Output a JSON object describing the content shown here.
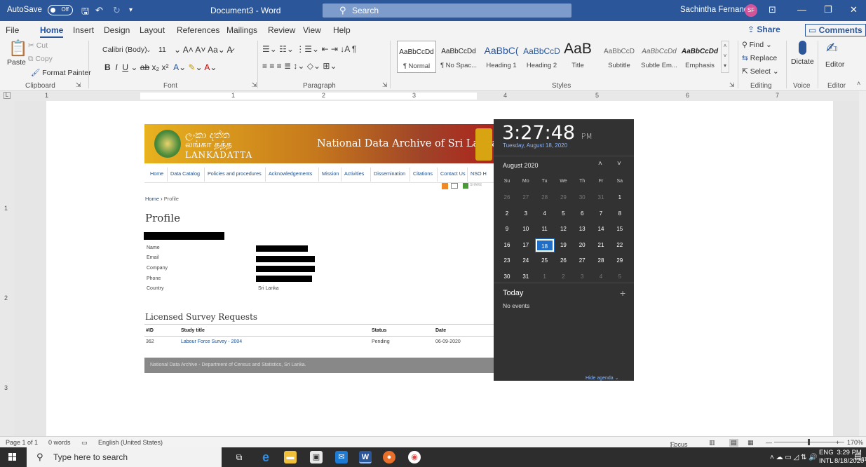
{
  "titlebar": {
    "autosave": "AutoSave",
    "toggle": "Off",
    "doc": "Document3 - Word",
    "search": "Search",
    "user": "Sachintha Fernando",
    "initials": "SF"
  },
  "menu": {
    "items": [
      "File",
      "Home",
      "Insert",
      "Design",
      "Layout",
      "References",
      "Mailings",
      "Review",
      "View",
      "Help"
    ],
    "share": "Share",
    "comments": "Comments"
  },
  "ribbon": {
    "clipboard": {
      "paste": "Paste",
      "cut": "Cut",
      "copy": "Copy",
      "format_painter": "Format Painter",
      "label": "Clipboard"
    },
    "font": {
      "name": "Calibri (Body)",
      "size": "11",
      "label": "Font"
    },
    "paragraph": {
      "label": "Paragraph"
    },
    "styles": {
      "label": "Styles",
      "items": [
        {
          "preview": "AaBbCcDd",
          "name": "¶ Normal"
        },
        {
          "preview": "AaBbCcDd",
          "name": "¶ No Spac..."
        },
        {
          "preview": "AaBbC(",
          "name": "Heading 1"
        },
        {
          "preview": "AaBbCcD",
          "name": "Heading 2"
        },
        {
          "preview": "AaB",
          "name": "Title"
        },
        {
          "preview": "AaBbCcD",
          "name": "Subtitle"
        },
        {
          "preview": "AaBbCcDd",
          "name": "Subtle Em..."
        },
        {
          "preview": "AaBbCcDd",
          "name": "Emphasis"
        }
      ]
    },
    "editing": {
      "find": "Find",
      "replace": "Replace",
      "select": "Select",
      "label": "Editing"
    },
    "voice": {
      "dictate": "Dictate",
      "label": "Voice"
    },
    "editor": {
      "name": "Editor",
      "label": "Editor"
    }
  },
  "ruler": {
    "marks": [
      "1",
      "1",
      "2",
      "3",
      "4",
      "5",
      "6",
      "7"
    ]
  },
  "site": {
    "logo_l1": "ලංකා දත්ත",
    "logo_l2": "லங்கா தத்த",
    "logo_l3": "LANKADATTA",
    "title": "National Data Archive of Sri Lanka",
    "nav": [
      "Home",
      "Data Catalog",
      "Policies and procedures",
      "Acknowledgements",
      "Mission",
      "Activities",
      "Dissemination",
      "Citations",
      "Contact Us",
      "NSO H"
    ],
    "share": "SHARE",
    "breadcrumb_home": "Home",
    "breadcrumb_sep": "›",
    "breadcrumb_cur": "Profile",
    "heading": "Profile",
    "fields": [
      {
        "label": "Name",
        "value": ""
      },
      {
        "label": "Email",
        "value": ""
      },
      {
        "label": "Company",
        "value": ""
      },
      {
        "label": "Phone",
        "value": ""
      },
      {
        "label": "Country",
        "value": "Sri Lanka"
      }
    ],
    "lsr_heading": "Licensed Survey Requests",
    "table": {
      "headers": [
        "#ID",
        "Study title",
        "Status",
        "Date"
      ],
      "rows": [
        [
          "362",
          "Labour Force Survey - 2004",
          "Pending",
          "06-09-2020"
        ]
      ]
    },
    "footer": "National Data Archive - Department of Census and Statistics, Sri Lanka."
  },
  "flyout": {
    "time": "3:27:48",
    "ampm": "PM",
    "date": "Tuesday, August 18, 2020",
    "month": "August 2020",
    "dows": [
      "Su",
      "Mo",
      "Tu",
      "We",
      "Th",
      "Fr",
      "Sa"
    ],
    "days": [
      [
        "26",
        "27",
        "28",
        "29",
        "30",
        "31",
        "1"
      ],
      [
        "2",
        "3",
        "4",
        "5",
        "6",
        "7",
        "8"
      ],
      [
        "9",
        "10",
        "11",
        "12",
        "13",
        "14",
        "15"
      ],
      [
        "16",
        "17",
        "18",
        "19",
        "20",
        "21",
        "22"
      ],
      [
        "23",
        "24",
        "25",
        "26",
        "27",
        "28",
        "29"
      ],
      [
        "30",
        "31",
        "1",
        "2",
        "3",
        "4",
        "5"
      ]
    ],
    "today": "Today",
    "no_events": "No events",
    "hide": "Hide agenda"
  },
  "status": {
    "page": "Page 1 of 1",
    "words": "0 words",
    "lang": "English (United States)",
    "focus": "Focus",
    "zoom": "170%"
  },
  "taskbar": {
    "search": "Type here to search",
    "lang1": "ENG",
    "lang2": "INTL",
    "time": "3:29 PM",
    "date": "8/18/2020",
    "notif": "21"
  }
}
